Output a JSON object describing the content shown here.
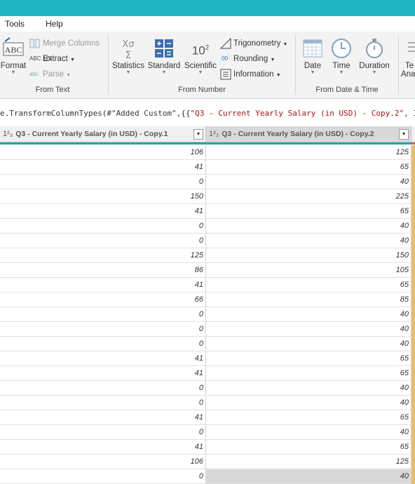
{
  "menu": {
    "tools": "Tools",
    "help": "Help"
  },
  "ribbon": {
    "from_text": {
      "label": "From Text",
      "format": "Format",
      "merge_columns": "Merge Columns",
      "extract": "Extract",
      "parse": "Parse",
      "abc_icon_text": "ABC",
      "abc123_icon_text": "ABC 123",
      "abc_small_icon_text": "abc"
    },
    "from_number": {
      "label": "From Number",
      "statistics": "Statistics",
      "standard": "Standard",
      "scientific": "Scientific",
      "scientific_icon": "10",
      "scientific_exp": "2",
      "trigonometry": "Trigonometry",
      "rounding": "Rounding",
      "information": "Information",
      "rounding_icon_text": ".00"
    },
    "from_date_time": {
      "label": "From Date & Time",
      "date": "Date",
      "time": "Time",
      "duration": "Duration",
      "text_analytics_1": "Te",
      "text_analytics_2": "Ana"
    }
  },
  "formula": {
    "prefix": "e.TransformColumnTypes(#\"Added Custom\",{{",
    "string": "\"Q3 - Current Yearly Salary (in USD) - Copy.2\"",
    "suffix": ", I"
  },
  "columns": [
    {
      "type_icon": "1²₃",
      "name": "Q3 - Current Yearly Salary (in USD) - Copy.1"
    },
    {
      "type_icon": "1²₃",
      "name": "Q3 - Current Yearly Salary (in USD) - Copy.2"
    }
  ],
  "rows": [
    [
      "106",
      "125"
    ],
    [
      "41",
      "65"
    ],
    [
      "0",
      "40"
    ],
    [
      "150",
      "225"
    ],
    [
      "41",
      "65"
    ],
    [
      "0",
      "40"
    ],
    [
      "0",
      "40"
    ],
    [
      "125",
      "150"
    ],
    [
      "86",
      "105"
    ],
    [
      "41",
      "65"
    ],
    [
      "66",
      "85"
    ],
    [
      "0",
      "40"
    ],
    [
      "0",
      "40"
    ],
    [
      "0",
      "40"
    ],
    [
      "41",
      "65"
    ],
    [
      "41",
      "65"
    ],
    [
      "0",
      "40"
    ],
    [
      "0",
      "40"
    ],
    [
      "41",
      "65"
    ],
    [
      "0",
      "40"
    ],
    [
      "41",
      "65"
    ],
    [
      "106",
      "125"
    ],
    [
      "0",
      "40"
    ]
  ],
  "colors": {
    "title": "#1fb5c0",
    "quality_bar": "#21a99c",
    "selected_header": "#d9d9d9"
  }
}
